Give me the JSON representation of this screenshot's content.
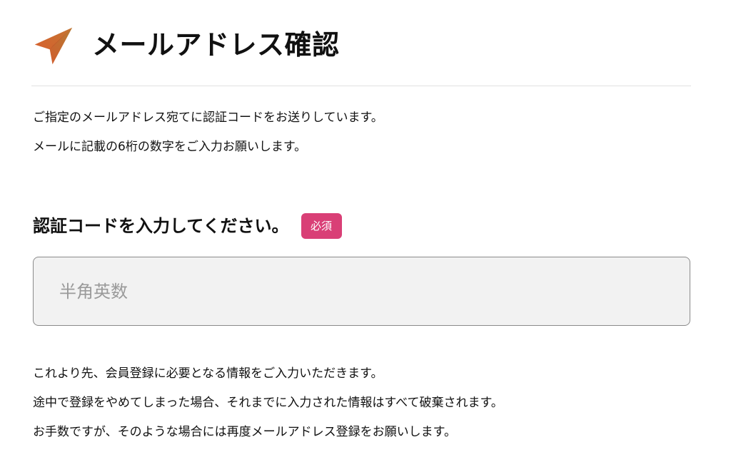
{
  "header": {
    "title": "メールアドレス確認",
    "icon": "paper-plane-icon"
  },
  "intro": {
    "lines": [
      "ご指定のメールアドレス宛てに認証コードをお送りしています。",
      "メールに記載の6桁の数字をご入力お願いします。"
    ]
  },
  "form": {
    "label": "認証コードを入力してください。",
    "required_badge": "必須",
    "placeholder": "半角英数",
    "value": ""
  },
  "notes": {
    "lines": [
      "これより先、会員登録に必要となる情報をご入力いただきます。",
      "途中で登録をやめてしまった場合、それまでに入力された情報はすべて破棄されます。",
      "お手数ですが、そのような場合には再度メールアドレス登録をお願いします。"
    ]
  },
  "colors": {
    "icon_gradient_start": "#d8552b",
    "icon_gradient_end": "#b67b34",
    "required_badge": "#d93f76",
    "input_background": "#f2f2f2",
    "input_border": "#8a8a8a"
  }
}
